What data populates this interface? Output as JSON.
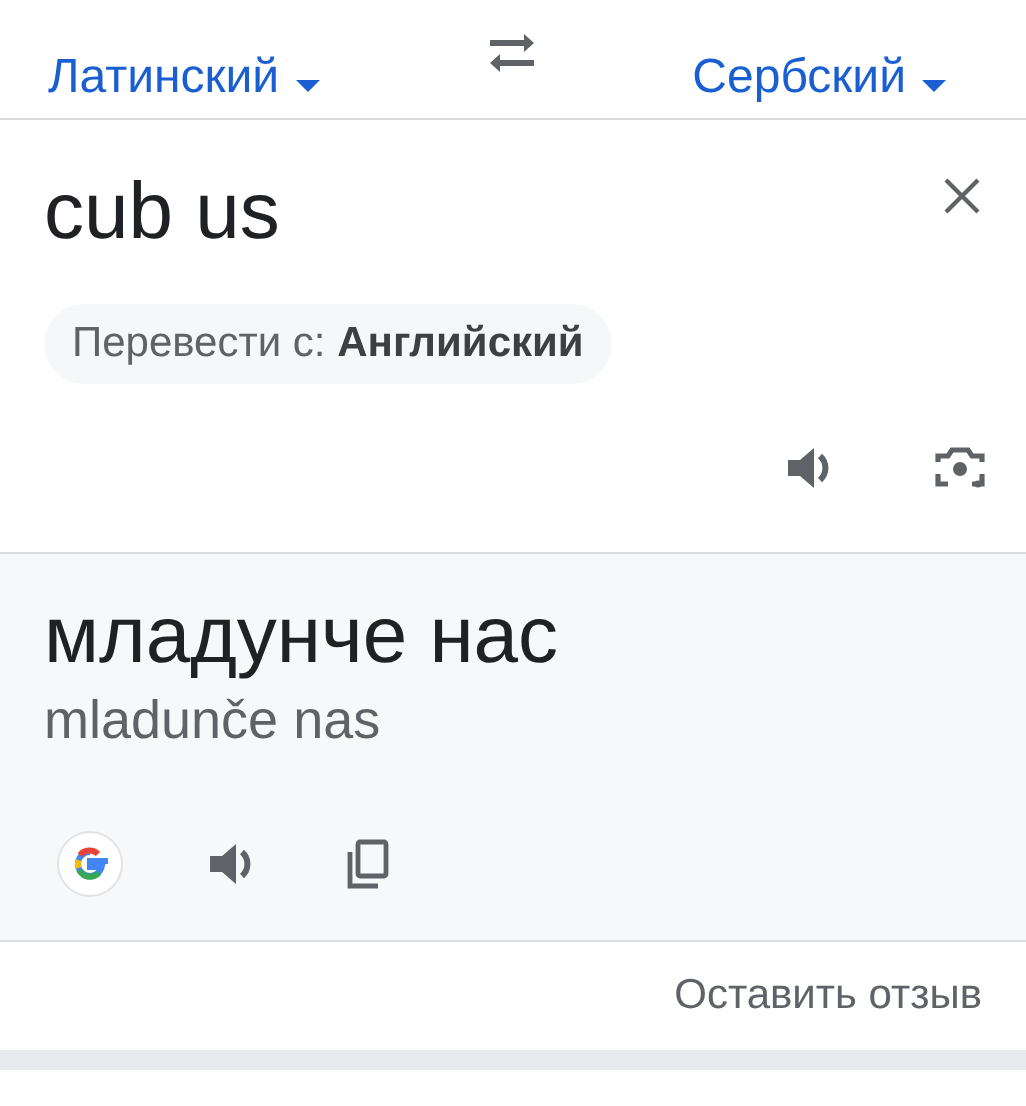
{
  "languages": {
    "source": "Латинский",
    "target": "Сербский"
  },
  "input": {
    "text": "cub us"
  },
  "detect_chip": {
    "text": "Перевести с: **Английский**"
  },
  "output": {
    "translation": "младунче нас",
    "transliteration": "mladunče nas"
  },
  "feedback": "Оставить отзыв"
}
